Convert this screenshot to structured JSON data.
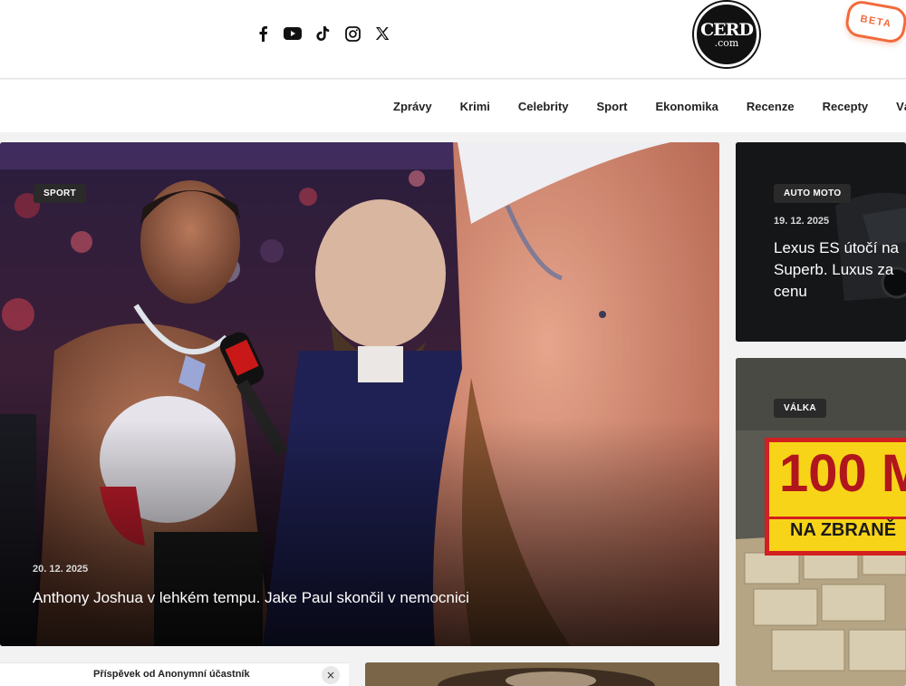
{
  "header": {
    "social_icons": [
      "facebook-icon",
      "youtube-icon",
      "tiktok-icon",
      "instagram-icon",
      "x-icon"
    ],
    "logo": {
      "line1": "CERD",
      "line2": ".com"
    },
    "beta_label": "BETA"
  },
  "nav": {
    "items": [
      "Zprávy",
      "Krimi",
      "Celebrity",
      "Sport",
      "Ekonomika",
      "Recenze",
      "Recepty",
      "Vá"
    ]
  },
  "hero": {
    "tag": "SPORT",
    "date": "20. 12. 2025",
    "title": "Anthony Joshua v lehkém tempu. Jake Paul skončil v nemocnici"
  },
  "side_cards": [
    {
      "tag": "AUTO MOTO",
      "date": "19. 12. 2025",
      "title": "Lexus ES útočí na Superb. Luxus za cenu"
    },
    {
      "tag": "VÁLKA",
      "sign_line1": "100 M",
      "sign_line2": "NA ZBRANĚ"
    }
  ],
  "sponsored": {
    "label": "Příspěvek od Anonymní účastník",
    "close": "×"
  },
  "colors": {
    "accent": "#f26a3c",
    "tag_bg": "#2a2a2a",
    "sign_red": "#d21f1f",
    "sign_yellow": "#f7d418"
  }
}
